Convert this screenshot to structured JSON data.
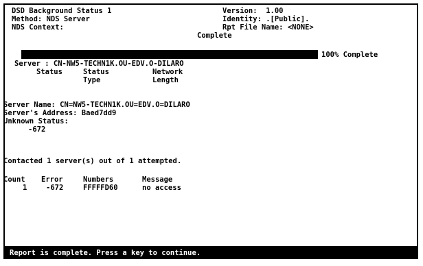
{
  "header": {
    "title": "DSD Background Status 1",
    "method": "Method: NDS Server",
    "context": "NDS Context:",
    "version": "Version:  1.00",
    "identity": "Identity: .[Public].",
    "report_file": "Rpt File Name: <NONE>",
    "complete_label": "Complete"
  },
  "progress": {
    "percent": 100,
    "label": "100% Complete"
  },
  "server_block": {
    "server_line": "Server : CN-NW5-TECHN1K.OU-EDV.O-DILARO",
    "col_status": "Status",
    "col_status_type_1": "Status",
    "col_status_type_2": "Type",
    "col_network_1": "Network",
    "col_network_2": "Length"
  },
  "details": {
    "server_name": "Server Name: CN=NW5-TECHN1K.OU=EDV.O=DILARO",
    "server_address": "Server's Address: Baed7dd9",
    "unknown_status": "Unknown Status:",
    "unknown_code": "-672",
    "contacted": "Contacted 1 server(s) out of 1 attempted."
  },
  "table": {
    "headers": [
      "Count",
      "Error",
      "Numbers",
      "Message"
    ],
    "rows": [
      [
        "1",
        "-672",
        "FFFFFD60",
        "no access"
      ]
    ]
  },
  "footer": {
    "status_text": "Report is complete. Press a key to continue."
  }
}
